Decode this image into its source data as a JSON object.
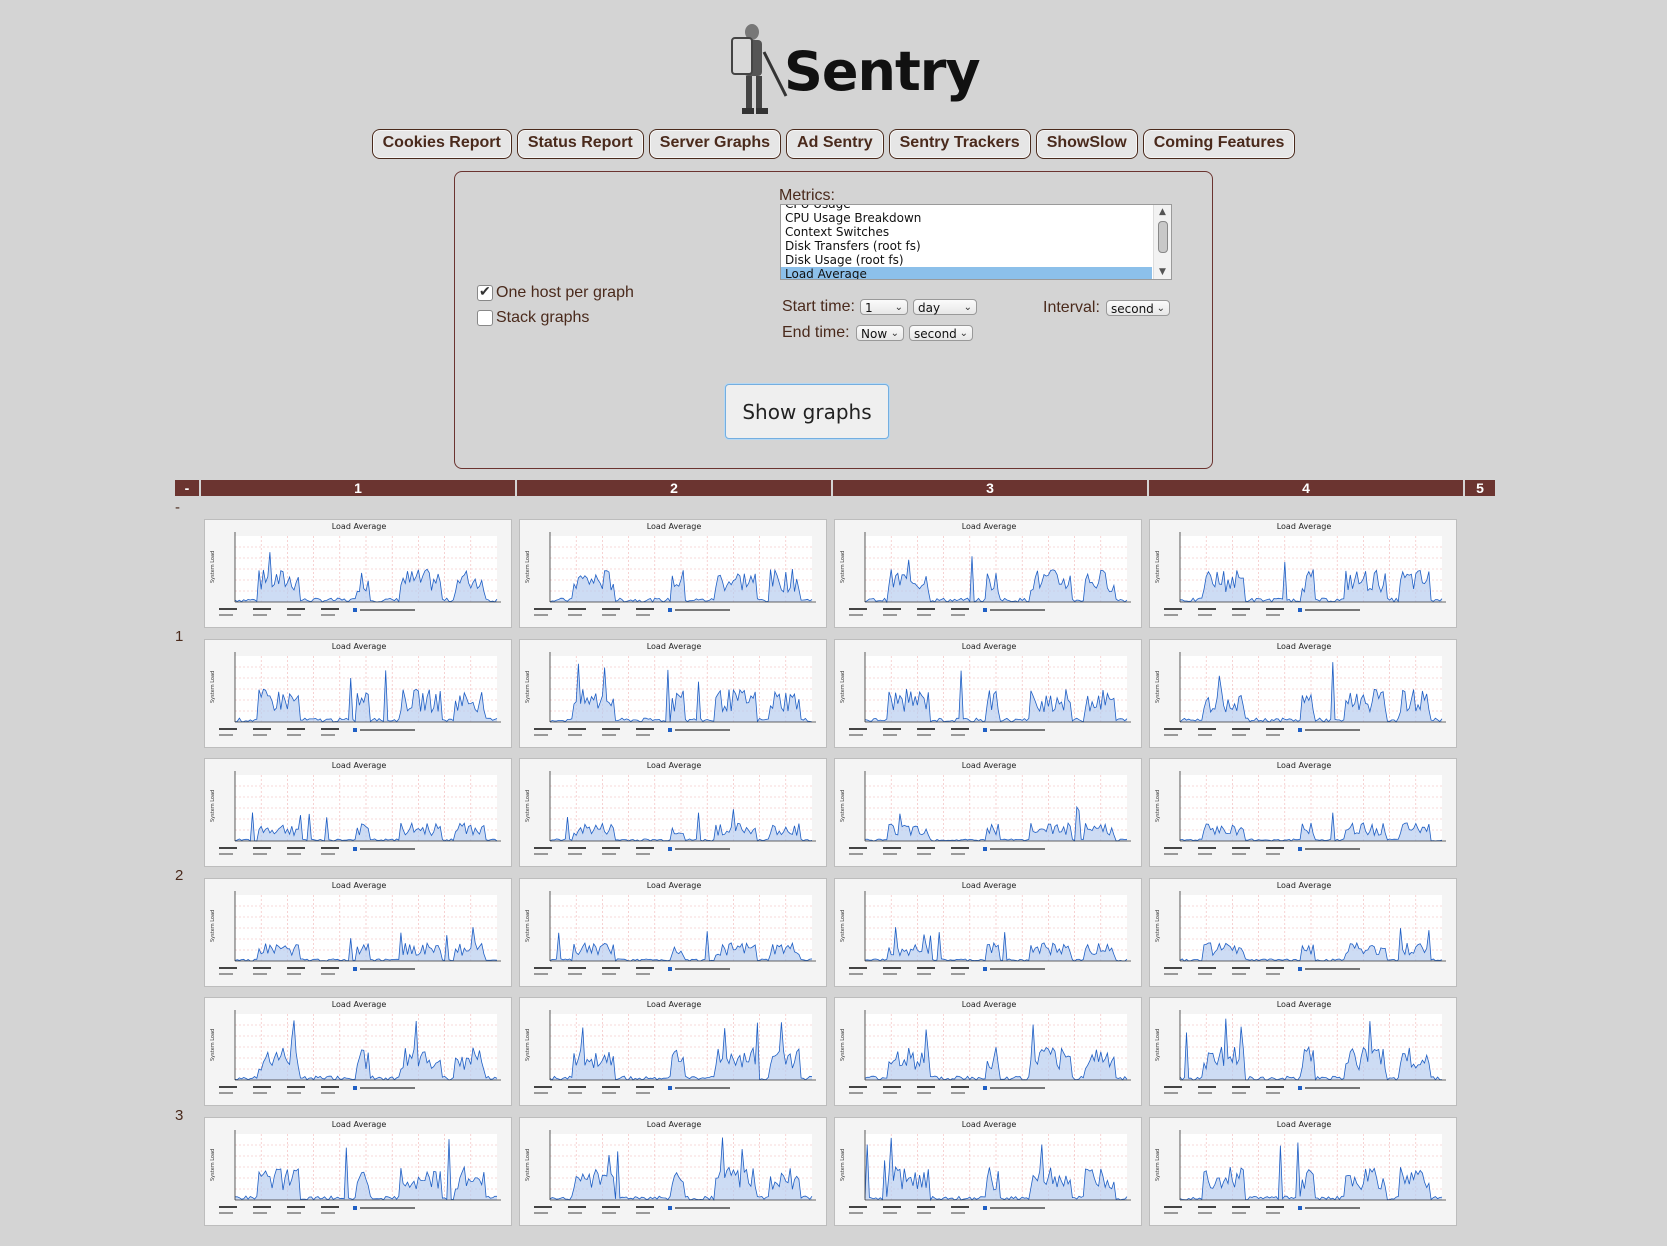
{
  "logo": {
    "text": "Sentry"
  },
  "nav": [
    {
      "label": "Cookies Report"
    },
    {
      "label": "Status Report"
    },
    {
      "label": "Server Graphs"
    },
    {
      "label": "Ad Sentry"
    },
    {
      "label": "Sentry Trackers"
    },
    {
      "label": "ShowSlow"
    },
    {
      "label": "Coming Features"
    }
  ],
  "form": {
    "metrics_label": "Metrics:",
    "metrics_options": [
      {
        "label": "CPU Usage"
      },
      {
        "label": "CPU Usage Breakdown"
      },
      {
        "label": "Context Switches"
      },
      {
        "label": "Disk Transfers (root fs)"
      },
      {
        "label": "Disk Usage (root fs)"
      },
      {
        "label": "Load Average",
        "selected": true
      }
    ],
    "one_host_label": "One host per graph",
    "one_host_checked": true,
    "stack_label": "Stack graphs",
    "stack_checked": false,
    "start_label": "Start time:",
    "start_value": "1",
    "start_unit": "day",
    "end_label": "End time:",
    "end_value": "Now",
    "end_unit": "second",
    "interval_label": "Interval:",
    "interval_value": "second",
    "show_button": "Show graphs"
  },
  "grid": {
    "corner": "-",
    "columns": [
      "1",
      "2",
      "3",
      "4",
      "5"
    ],
    "empty_row_label": "-",
    "row_labels": [
      "1",
      "2",
      "3"
    ],
    "graph_title": "Load Average",
    "y_axis_label": "System Load"
  },
  "colors": {
    "accent": "#6b3430",
    "background": "#d4d4d4",
    "text": "#4a2a1c",
    "line": "#1f5fc4",
    "fill": "#b8cdef"
  }
}
